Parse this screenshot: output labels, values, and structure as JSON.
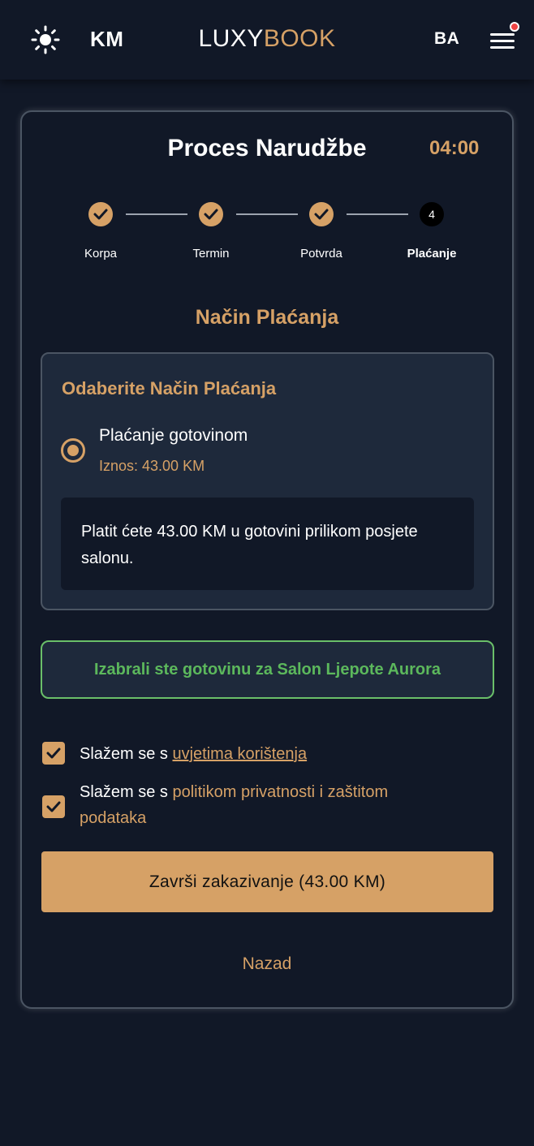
{
  "header": {
    "theme_icon": "sun-icon",
    "currency": "KM",
    "logo_part1": "LUXY",
    "logo_part2": "BOOK",
    "language": "BA",
    "menu_icon": "hamburger-menu-icon",
    "notification_color": "#ef4444"
  },
  "order": {
    "title": "Proces Narudžbe",
    "timer": "04:00",
    "steps": [
      {
        "label": "Korpa",
        "state": "done"
      },
      {
        "label": "Termin",
        "state": "done"
      },
      {
        "label": "Potvrda",
        "state": "done"
      },
      {
        "label": "Plaćanje",
        "state": "current",
        "number": "4"
      }
    ]
  },
  "payment": {
    "section_title": "Način Plaćanja",
    "box_title": "Odaberite Način Plaćanja",
    "option_label": "Plaćanje gotovinom",
    "option_amount": "Iznos: 43.00 KM",
    "info_text": "Platit ćete 43.00 KM u gotovini prilikom posjete salonu.",
    "selected_message": "Izabrali ste gotovinu za Salon Ljepote Aurora"
  },
  "agreements": {
    "terms_prefix": "Slažem se s ",
    "terms_link": "uvjetima korištenja",
    "privacy_prefix": "Slažem se s ",
    "privacy_link": "politikom privatnosti i zaštitom podataka",
    "terms_checked": true,
    "privacy_checked": true
  },
  "actions": {
    "submit_label": "Završi zakazivanje (43.00 KM)",
    "back_label": "Nazad"
  },
  "colors": {
    "accent": "#d6a166",
    "background": "#111827",
    "success": "#5cb85c"
  }
}
